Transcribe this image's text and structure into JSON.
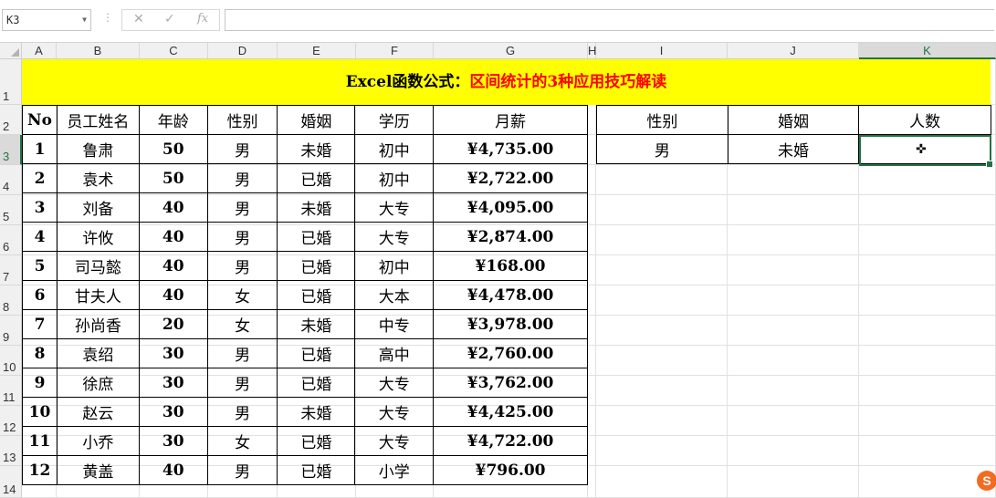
{
  "formula_bar": {
    "name_box": "K3",
    "formula": "",
    "fx": "fx",
    "cancel": "✕",
    "confirm": "✓"
  },
  "columns": [
    "A",
    "B",
    "C",
    "D",
    "E",
    "F",
    "G",
    "H",
    "I",
    "J",
    "K"
  ],
  "rows": [
    "1",
    "2",
    "3",
    "4",
    "5",
    "6",
    "7",
    "8",
    "9",
    "10",
    "11",
    "12",
    "13",
    "14"
  ],
  "selected_cell": "K3",
  "title": {
    "prefix": "Excel函数公式：",
    "suffix": "区间统计的3种应用技巧解读"
  },
  "main_table": {
    "headers": [
      "No",
      "员工姓名",
      "年龄",
      "性别",
      "婚姻",
      "学历",
      "月薪"
    ],
    "rows": [
      [
        "1",
        "鲁肃",
        "50",
        "男",
        "未婚",
        "初中",
        "¥4,735.00"
      ],
      [
        "2",
        "袁术",
        "50",
        "男",
        "已婚",
        "初中",
        "¥2,722.00"
      ],
      [
        "3",
        "刘备",
        "40",
        "男",
        "未婚",
        "大专",
        "¥4,095.00"
      ],
      [
        "4",
        "许攸",
        "40",
        "男",
        "已婚",
        "大专",
        "¥2,874.00"
      ],
      [
        "5",
        "司马懿",
        "40",
        "男",
        "已婚",
        "初中",
        "¥168.00"
      ],
      [
        "6",
        "甘夫人",
        "40",
        "女",
        "已婚",
        "大本",
        "¥4,478.00"
      ],
      [
        "7",
        "孙尚香",
        "20",
        "女",
        "未婚",
        "中专",
        "¥3,978.00"
      ],
      [
        "8",
        "袁绍",
        "30",
        "男",
        "已婚",
        "高中",
        "¥2,760.00"
      ],
      [
        "9",
        "徐庶",
        "30",
        "男",
        "已婚",
        "大专",
        "¥3,762.00"
      ],
      [
        "10",
        "赵云",
        "30",
        "男",
        "未婚",
        "大专",
        "¥4,425.00"
      ],
      [
        "11",
        "小乔",
        "30",
        "女",
        "已婚",
        "大专",
        "¥4,722.00"
      ],
      [
        "12",
        "黄盖",
        "40",
        "男",
        "已婚",
        "小学",
        "¥796.00"
      ]
    ]
  },
  "criteria_table": {
    "headers": [
      "性别",
      "婚姻",
      "人数"
    ],
    "row": [
      "男",
      "未婚",
      ""
    ]
  },
  "tray_icon": "S"
}
